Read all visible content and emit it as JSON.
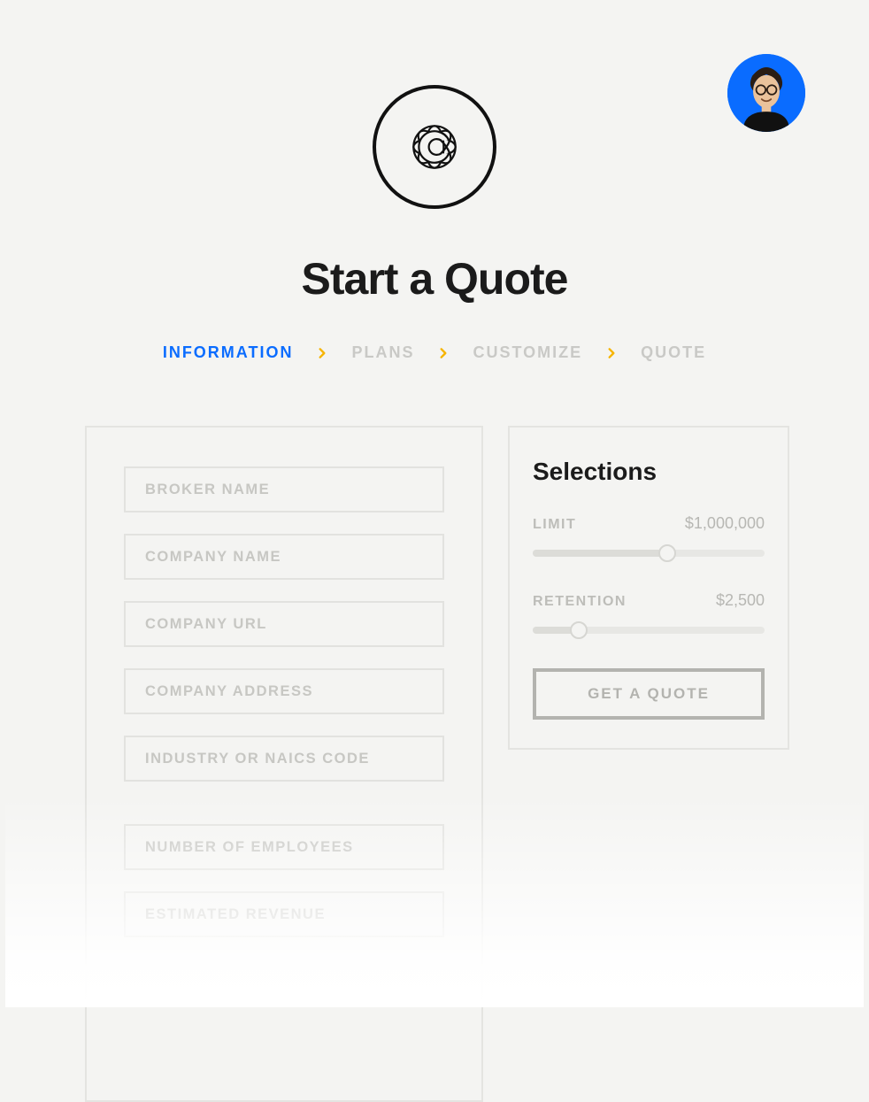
{
  "title": "Start a Quote",
  "steps": [
    {
      "label": "INFORMATION",
      "active": true
    },
    {
      "label": "PLANS",
      "active": false
    },
    {
      "label": "CUSTOMIZE",
      "active": false
    },
    {
      "label": "QUOTE",
      "active": false
    }
  ],
  "form": {
    "fields_group1": [
      {
        "name": "broker-name",
        "placeholder": "BROKER NAME"
      },
      {
        "name": "company-name",
        "placeholder": "COMPANY NAME"
      },
      {
        "name": "company-url",
        "placeholder": "COMPANY URL"
      },
      {
        "name": "company-address",
        "placeholder": "COMPANY ADDRESS"
      },
      {
        "name": "industry-code",
        "placeholder": "INDUSTRY OR NAICS CODE"
      }
    ],
    "fields_group2": [
      {
        "name": "num-employees",
        "placeholder": "NUMBER OF EMPLOYEES"
      },
      {
        "name": "estimated-revenue",
        "placeholder": "ESTIMATED REVENUE"
      }
    ]
  },
  "selections": {
    "title": "Selections",
    "limit": {
      "label": "LIMIT",
      "value": "$1,000,000",
      "percent": 58
    },
    "retention": {
      "label": "RETENTION",
      "value": "$2,500",
      "percent": 20
    },
    "cta": "GET A QUOTE"
  },
  "colors": {
    "accent_blue": "#0a6cff",
    "accent_yellow": "#f6b400"
  }
}
